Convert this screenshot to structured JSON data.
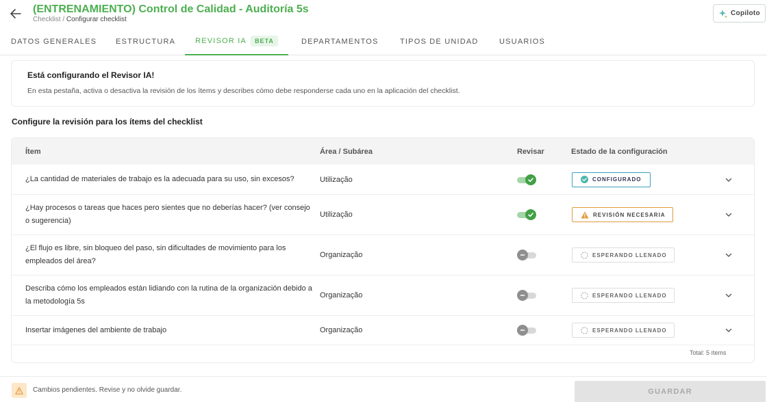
{
  "header": {
    "title": "(ENTRENAMIENTO) Control de Calidad - Auditoría 5s",
    "breadcrumb_root": "Checklist",
    "breadcrumb_sep": " / ",
    "breadcrumb_current": "Configurar checklist",
    "copilot_label": "Copiloto",
    "accent_color": "#4caf50"
  },
  "tabs": [
    {
      "label": "DATOS GENERALES"
    },
    {
      "label": "ESTRUCTURA"
    },
    {
      "label": "REVISOR IA",
      "badge": "BETA",
      "active": true
    },
    {
      "label": "DEPARTAMENTOS"
    },
    {
      "label": "TIPOS DE UNIDAD"
    },
    {
      "label": "USUARIOS"
    }
  ],
  "info": {
    "title": "Está configurando el Revisor IA!",
    "description": "En esta pestaña, activa o desactiva la revisión de los ítems y describes cómo debe responderse cada uno en la aplicación del checklist."
  },
  "section_title": "Configure la revisión para los ítems del checklist",
  "table": {
    "headers": {
      "item": "Ítem",
      "area": "Área / Subárea",
      "review": "Revisar",
      "status": "Estado de la configuración"
    },
    "rows": [
      {
        "item": "¿La cantidad de materiales de trabajo es la adecuada para su uso, sin excesos?",
        "area": "Utilização",
        "review": true,
        "status": "CONFIGURADO"
      },
      {
        "item": "¿Hay procesos o tareas que haces pero sientes que no deberías hacer? (ver consejo o sugerencia)",
        "area": "Utilização",
        "review": true,
        "status": "REVISIÓN NECESARIA"
      },
      {
        "item": "¿El flujo es libre, sin bloqueo del paso, sin dificultades de movimiento para los empleados del área?",
        "area": "Organização",
        "review": false,
        "status": "ESPERANDO LLENADO"
      },
      {
        "item": "Describa cómo los empleados están lidiando con la rutina de la organización debido a la metodología 5s",
        "area": "Organização",
        "review": false,
        "status": "ESPERANDO LLENADO"
      },
      {
        "item": "Insertar imágenes del ambiente de trabajo",
        "area": "Organização",
        "review": false,
        "status": "ESPERANDO LLENADO"
      }
    ],
    "total": "Total: 5 ítems"
  },
  "footer": {
    "message": "Cambios pendientes. Revise y no olvide guardar.",
    "save_label": "GUARDAR"
  },
  "icons": {
    "back": "arrow-left-icon",
    "copilot": "sparkle-icon",
    "check": "check-circle-icon",
    "warning": "warning-triangle-icon",
    "pending": "dashed-circle-icon",
    "expand": "chevron-down-icon"
  },
  "colors": {
    "configured_border": "#3ba1bd",
    "configured_icon": "#4db6ac",
    "warning": "#e09a3e",
    "toggle_on": "#43a047"
  }
}
